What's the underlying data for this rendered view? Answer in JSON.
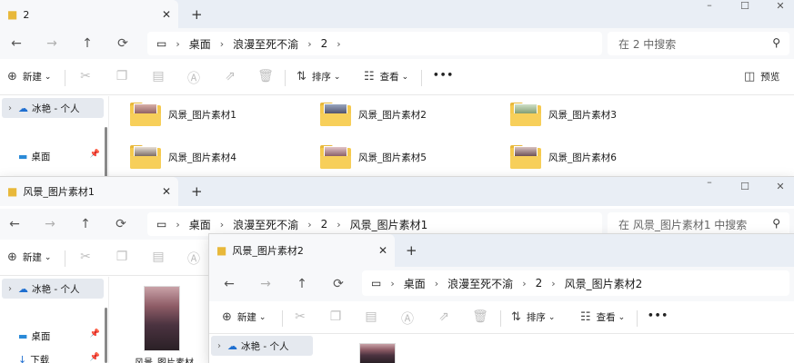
{
  "colors": {
    "accent": "#0067c0",
    "folder": "#f5c94e",
    "titlebar": "#e9eef5"
  },
  "icons": {
    "back": "←",
    "forward": "→",
    "up": "↑",
    "refresh": "⟳",
    "monitor": "▭",
    "chevron": "›",
    "search": "⚲",
    "close": "✕",
    "plus": "+",
    "minimize": "–",
    "maximize": "☐"
  },
  "window1": {
    "tab_title": "2",
    "breadcrumb": [
      "桌面",
      "浪漫至死不渝",
      "2"
    ],
    "search_placeholder": "在 2 中搜索",
    "toolbar": {
      "new": "新建",
      "sort": "排序",
      "view": "查看",
      "more": "•••",
      "preview": "预览"
    },
    "sidebar": [
      {
        "label": "冰艳 - 个人"
      },
      {
        "label": "桌面"
      }
    ],
    "items": [
      "风景_图片素材1",
      "风景_图片素材2",
      "风景_图片素材3",
      "风景_图片素材4",
      "风景_图片素材5",
      "风景_图片素材6"
    ]
  },
  "window2": {
    "tab_title": "风景_图片素材1",
    "breadcrumb": [
      "桌面",
      "浪漫至死不渝",
      "2",
      "风景_图片素材1"
    ],
    "search_placeholder": "在 风景_图片素材1 中搜索",
    "toolbar": {
      "new": "新建"
    },
    "sidebar": [
      {
        "label": "冰艳 - 个人"
      },
      {
        "label": "桌面"
      },
      {
        "label": "下载"
      }
    ],
    "file_label": "风景_图片素材"
  },
  "window3": {
    "tab_title": "风景_图片素材2",
    "breadcrumb": [
      "桌面",
      "浪漫至死不渝",
      "2",
      "风景_图片素材2"
    ],
    "toolbar": {
      "new": "新建",
      "sort": "排序",
      "view": "查看",
      "more": "•••"
    },
    "sidebar": [
      {
        "label": "冰艳 - 个人"
      }
    ]
  }
}
